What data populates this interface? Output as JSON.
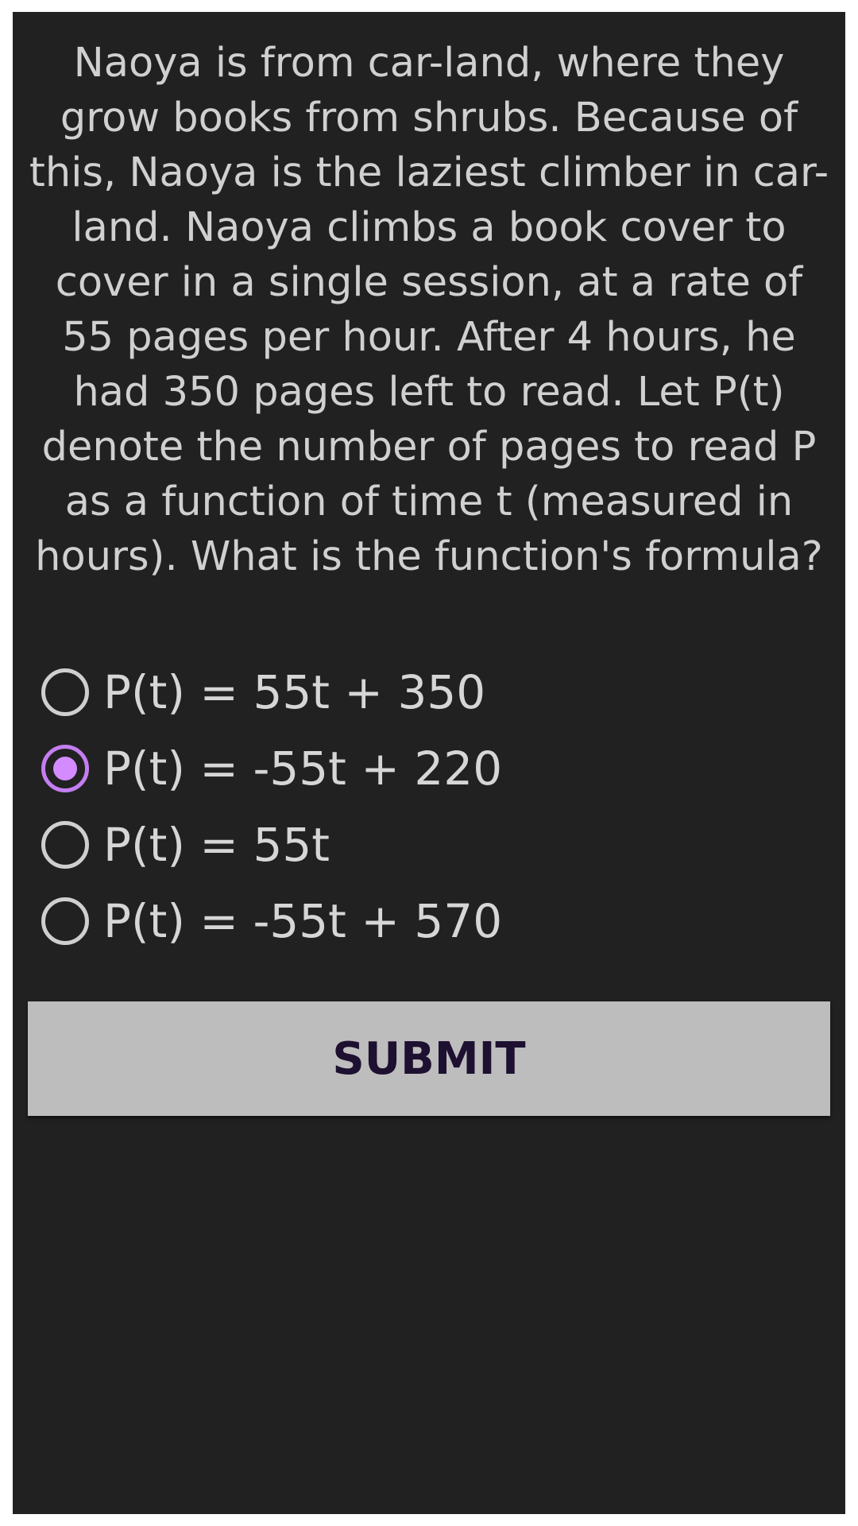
{
  "question": {
    "text": "Naoya is from car-land, where they grow books from shrubs. Because of this, Naoya is the laziest climber in car-land. Naoya climbs a book cover to cover in a single session, at a rate of 55 pages per hour. After 4 hours, he had 350 pages left to read. Let P(t) denote the number of pages to read P as a function of time t (measured in hours). What is the function's formula?"
  },
  "options": [
    {
      "label": "P(t) = 55t + 350",
      "selected": false
    },
    {
      "label": "P(t) = -55t + 220",
      "selected": true
    },
    {
      "label": "P(t) = 55t",
      "selected": false
    },
    {
      "label": "P(t) = -55t + 570",
      "selected": false
    }
  ],
  "submit": {
    "label": "SUBMIT"
  },
  "colors": {
    "panel_background": "#212121",
    "text": "#d0d0d0",
    "radio_accent": "#c47ef0",
    "button_background": "#bdbdbd",
    "button_text": "#1d1030"
  }
}
